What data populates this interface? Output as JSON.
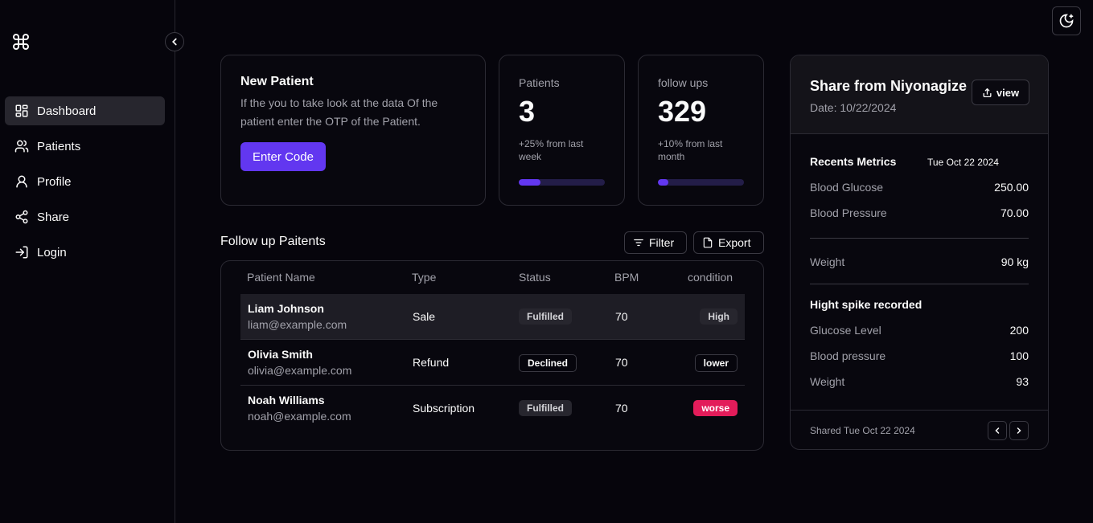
{
  "sidebar": {
    "items": [
      {
        "label": "Dashboard",
        "icon": "dashboard-icon"
      },
      {
        "label": "Patients",
        "icon": "users-icon"
      },
      {
        "label": "Profile",
        "icon": "user-icon"
      },
      {
        "label": "Share",
        "icon": "share-icon"
      },
      {
        "label": "Login",
        "icon": "login-icon"
      }
    ]
  },
  "new_patient": {
    "title": "New Patient",
    "description": "If the you to take look at the data Of the patient enter the OTP of the Patient.",
    "button": "Enter Code"
  },
  "stats": [
    {
      "label": "Patients",
      "value": "3",
      "sub": "+25% from last week",
      "progress": 0.25
    },
    {
      "label": "follow ups",
      "value": "329",
      "sub": "+10% from last month",
      "progress": 0.12
    }
  ],
  "follow_up": {
    "title": "Follow up Paitents",
    "filter_label": "Filter",
    "export_label": "Export",
    "columns": [
      "Patient Name",
      "Type",
      "Status",
      "BPM",
      "condition"
    ],
    "rows": [
      {
        "name": "Liam Johnson",
        "email": "liam@example.com",
        "type": "Sale",
        "status": "Fulfilled",
        "bpm": "70",
        "condition": "High"
      },
      {
        "name": "Olivia Smith",
        "email": "olivia@example.com",
        "type": "Refund",
        "status": "Declined",
        "bpm": "70",
        "condition": "lower"
      },
      {
        "name": "Noah Williams",
        "email": "noah@example.com",
        "type": "Subscription",
        "status": "Fulfilled",
        "bpm": "70",
        "condition": "worse"
      }
    ]
  },
  "share": {
    "title": "Share from Niyonagize",
    "date": "Date: 10/22/2024",
    "view_label": "view",
    "recent_title": "Recents Metrics",
    "recent_date": "Tue Oct 22 2024",
    "metrics": [
      {
        "k": "Blood Glucose",
        "v": "250.00"
      },
      {
        "k": "Blood Pressure",
        "v": "70.00"
      }
    ],
    "weight": {
      "k": "Weight",
      "v": "90 kg"
    },
    "spike_title": "Hight spike recorded",
    "spikes": [
      {
        "k": "Glucose Level",
        "v": "200"
      },
      {
        "k": "Blood pressure",
        "v": "100"
      },
      {
        "k": "Weight",
        "v": "93"
      }
    ],
    "footer": "Shared Tue Oct 22 2024"
  },
  "colors": {
    "accent": "#6237f0",
    "danger": "#e31c5a",
    "background": "#06050c"
  }
}
